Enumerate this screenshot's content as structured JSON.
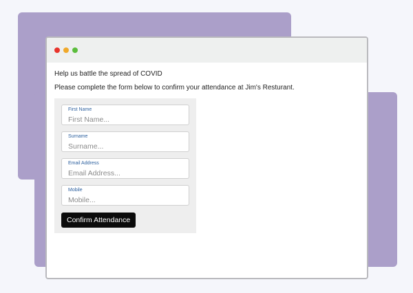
{
  "window": {
    "controls": [
      {
        "name": "close",
        "color": "#e8342b"
      },
      {
        "name": "minimize",
        "color": "#f0a92a"
      },
      {
        "name": "maximize",
        "color": "#5bbd3c"
      }
    ]
  },
  "page": {
    "heading": "Help us battle the spread of COVID",
    "instruction": "Please complete the form below to confirm your attendance at Jim's Resturant."
  },
  "form": {
    "first_name": {
      "label": "First Name",
      "placeholder": "First Name..."
    },
    "surname": {
      "label": "Surname",
      "placeholder": "Surname..."
    },
    "email": {
      "label": "Email Address",
      "placeholder": "Email Address..."
    },
    "mobile": {
      "label": "Mobile",
      "placeholder": "Mobile..."
    },
    "submit_label": "Confirm Attendance"
  },
  "colors": {
    "background_card": "#ab9fc9",
    "form_panel": "#eeeeee",
    "label_text": "#2b5f9e",
    "button": "#0b0b0b"
  }
}
